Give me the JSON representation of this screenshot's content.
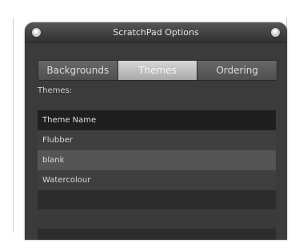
{
  "window": {
    "title": "ScratchPad Options"
  },
  "tabs": [
    {
      "label": "Backgrounds",
      "active": false
    },
    {
      "label": "Themes",
      "active": true
    },
    {
      "label": "Ordering",
      "active": false
    }
  ],
  "themes_section": {
    "label": "Themes:"
  },
  "table": {
    "header": "Theme Name",
    "rows": [
      "Flubber",
      "blank",
      "Watercolour"
    ]
  },
  "icons": {
    "close": "close-icon",
    "options": "options-icon"
  },
  "colors": {
    "window_bg": "#3b3b3b",
    "tab_active": "#bdbdbd",
    "header": "#1f1f1f"
  }
}
